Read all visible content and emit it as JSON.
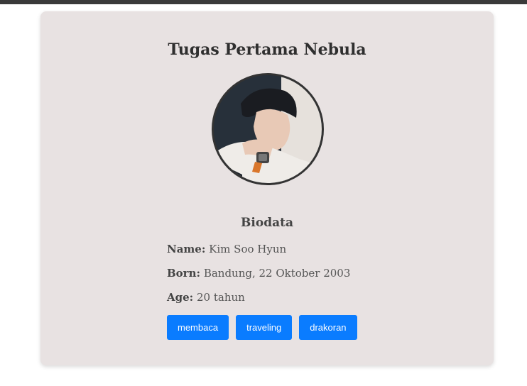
{
  "card": {
    "title": "Tugas Pertama Nebula",
    "subtitle": "Biodata"
  },
  "biodata": {
    "name_label": "Name:",
    "name_value": "Kim Soo Hyun",
    "born_label": "Born:",
    "born_value": "Bandung, 22 Oktober 2003",
    "age_label": "Age:",
    "age_value": "20 tahun"
  },
  "hobbies": [
    "membaca",
    "traveling",
    "drakoran"
  ],
  "colors": {
    "button": "#0a7cff",
    "card_bg": "#e8e2e2"
  }
}
